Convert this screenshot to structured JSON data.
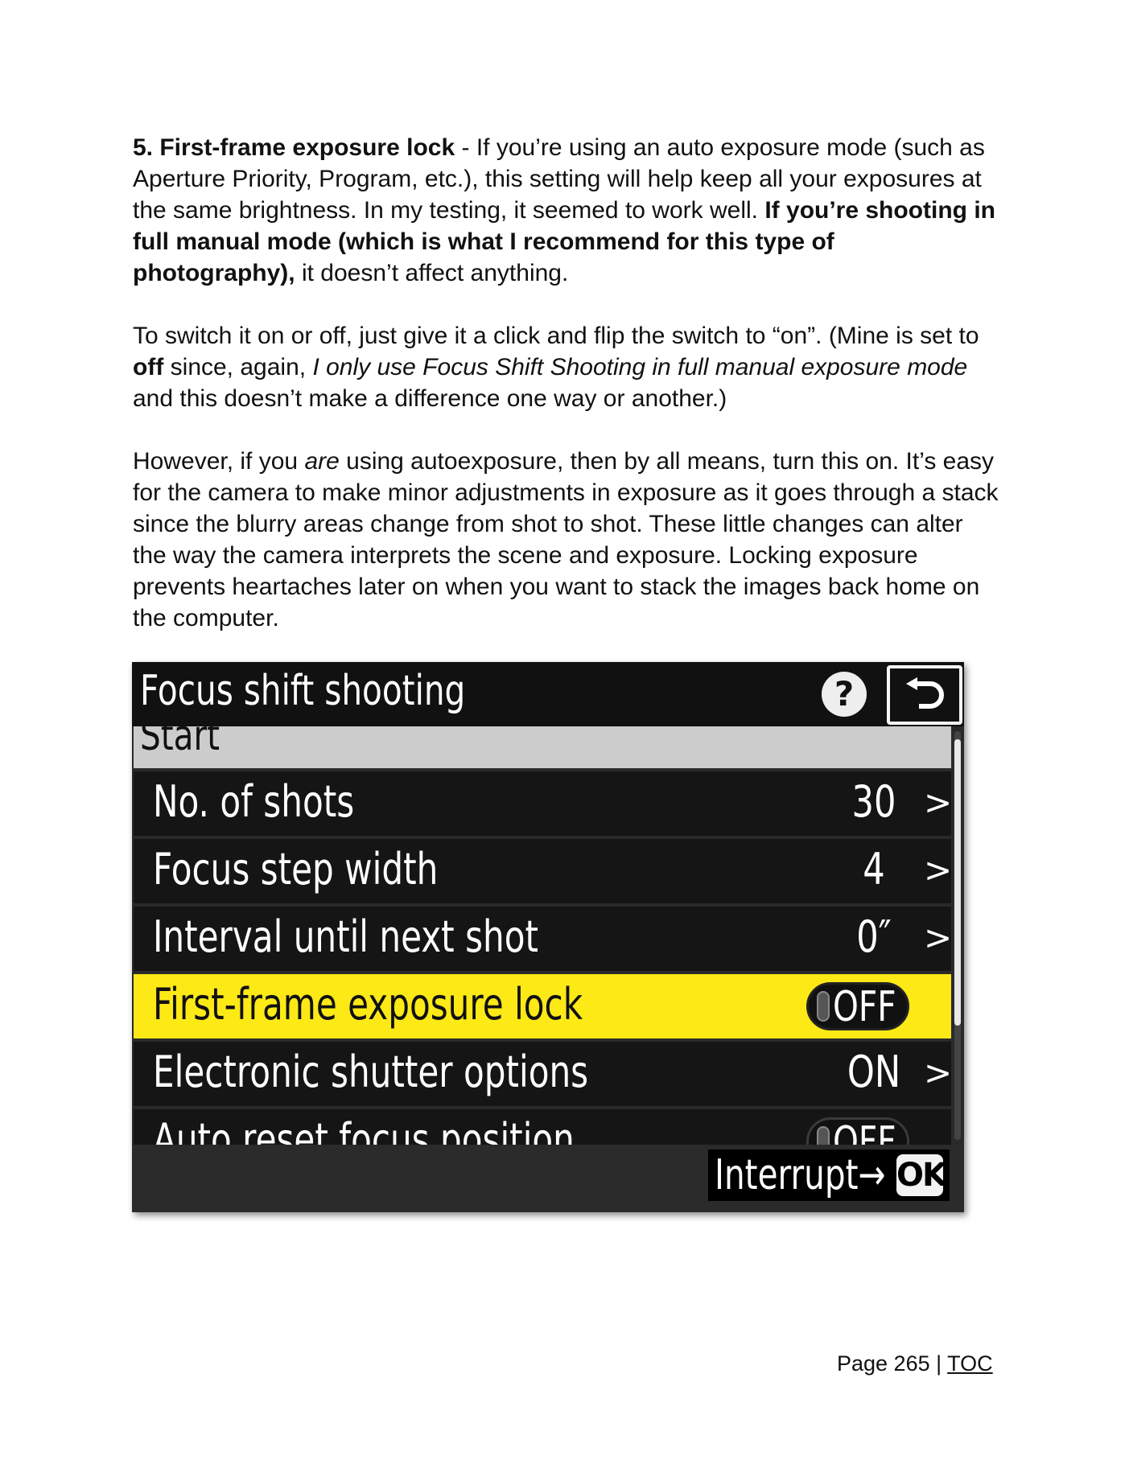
{
  "document": {
    "p1": {
      "heading": "5. First-frame exposure lock",
      "sep": " - ",
      "text1": "If you’re using an auto exposure mode (such as Aperture Priority, Program, etc.), this setting will help keep all your exposures at the same brightness. In my testing, it seemed to work well. ",
      "bold": "If you’re shooting in full manual mode (which is what I recommend for this type of photography),",
      "text2": " it doesn’t affect anything."
    },
    "p2": {
      "text1": "To switch it on or off, just give it a click and flip the switch to “on”. (Mine is set to ",
      "bold": "off",
      "text2": " since, again, ",
      "italic": "I only use Focus Shift Shooting in full manual exposure mode",
      "text3": " and this doesn’t make a difference one way or another.)"
    },
    "p3": {
      "text1": "However, if you ",
      "italic": "are",
      "text2": " using autoexposure, then by all means, turn this on. It’s easy for the camera to make minor adjustments in exposure as it goes through a stack since the blurry areas change from shot to shot. These little changes can alter the way the camera interprets the scene and exposure. Locking exposure prevents heartaches later on when you want to stack the images back home on the computer."
    }
  },
  "camera_menu": {
    "title": "Focus shift shooting",
    "help_icon": "?",
    "start_label": "Start",
    "rows": [
      {
        "label": "No. of shots",
        "value": "30",
        "chevron": ">"
      },
      {
        "label": "Focus step width",
        "value": "4",
        "chevron": ">"
      },
      {
        "label": "Interval until next shot",
        "value": "0″",
        "chevron": ">"
      },
      {
        "label": "First-frame exposure lock",
        "value": "OFF"
      },
      {
        "label": "Electronic shutter options",
        "value": "ON",
        "chevron": ">"
      },
      {
        "label": "Auto reset focus position",
        "value": "OFF"
      }
    ],
    "footer": {
      "interrupt": "Interrupt→",
      "ok": "OK"
    },
    "colors": {
      "highlight": "#fde916",
      "background": "#151515"
    }
  },
  "page_footer": {
    "page": "Page 265 | ",
    "toc": "TOC"
  }
}
